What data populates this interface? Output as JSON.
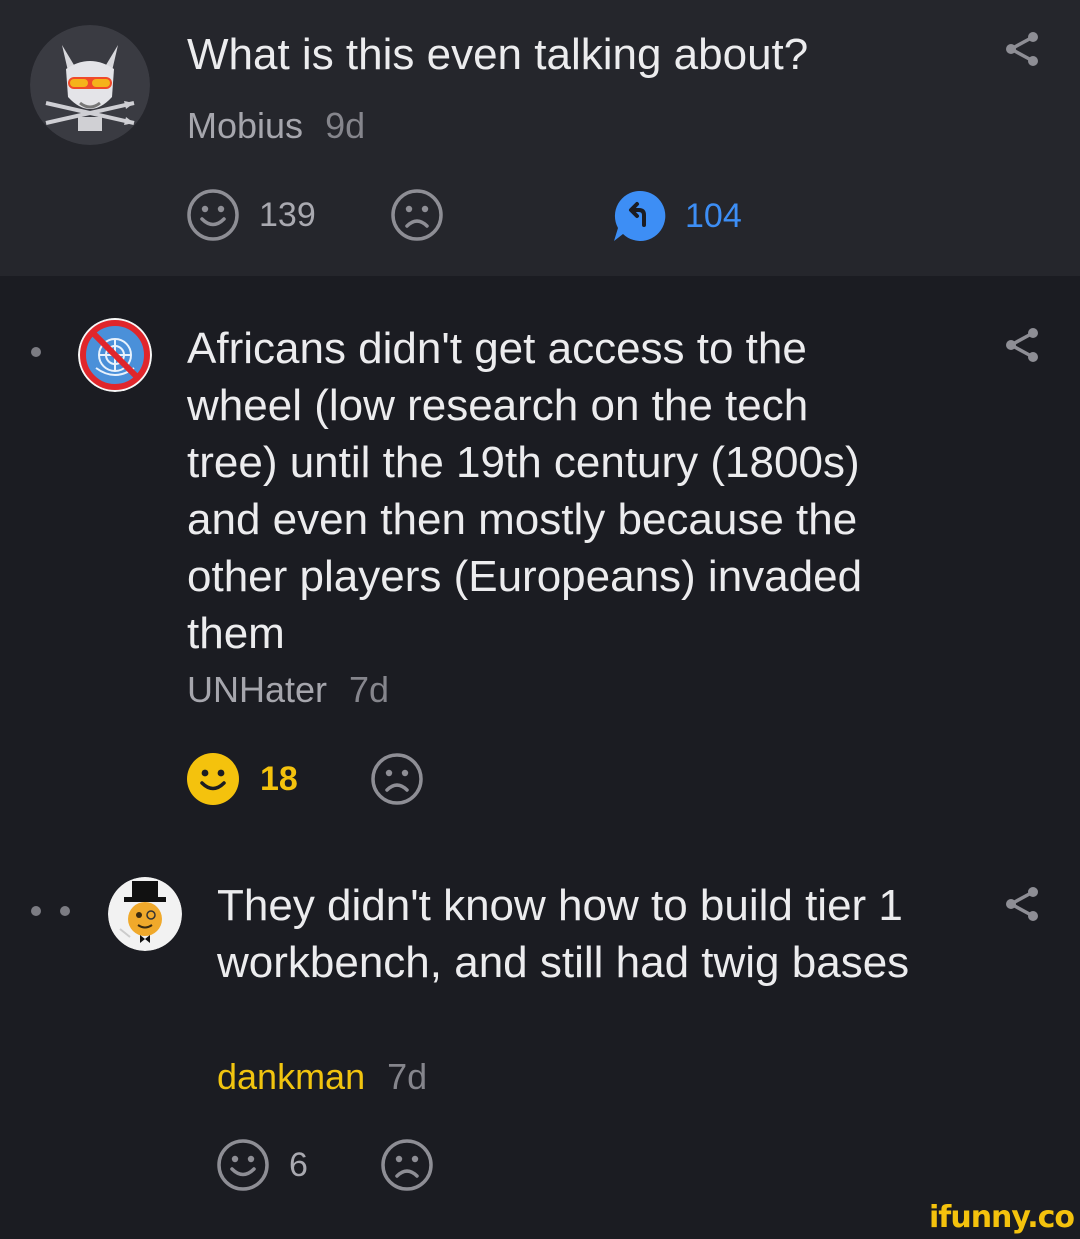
{
  "comments": [
    {
      "text": "What is this even talking about?",
      "author": "Mobius",
      "age": "9d",
      "likes": "139",
      "replies": "104",
      "avatar": "wolf-sunglasses-avatar"
    },
    {
      "text": "Africans didn't get access to the wheel (low research on the tech tree) until the 19th century (1800s) and even then mostly because the other players (Europeans) invaded them",
      "author": "UNHater",
      "age": "7d",
      "likes": "18",
      "avatar": "no-un-avatar"
    },
    {
      "text": "They didn't know how to build tier 1 workbench, and still had twig bases",
      "author": "dankman",
      "age": "7d",
      "likes": "6",
      "avatar": "top-hat-meme-avatar"
    }
  ],
  "icons": {
    "share": "share-icon",
    "smile": "smile-icon",
    "frown": "frown-icon",
    "reply": "reply-bubble-icon"
  },
  "colors": {
    "background": "#1b1c22",
    "top_comment_bg": "#25262c",
    "accent_yellow": "#f4c20d",
    "reply_blue": "#3d8ef5"
  },
  "watermark": "ifunny.co"
}
